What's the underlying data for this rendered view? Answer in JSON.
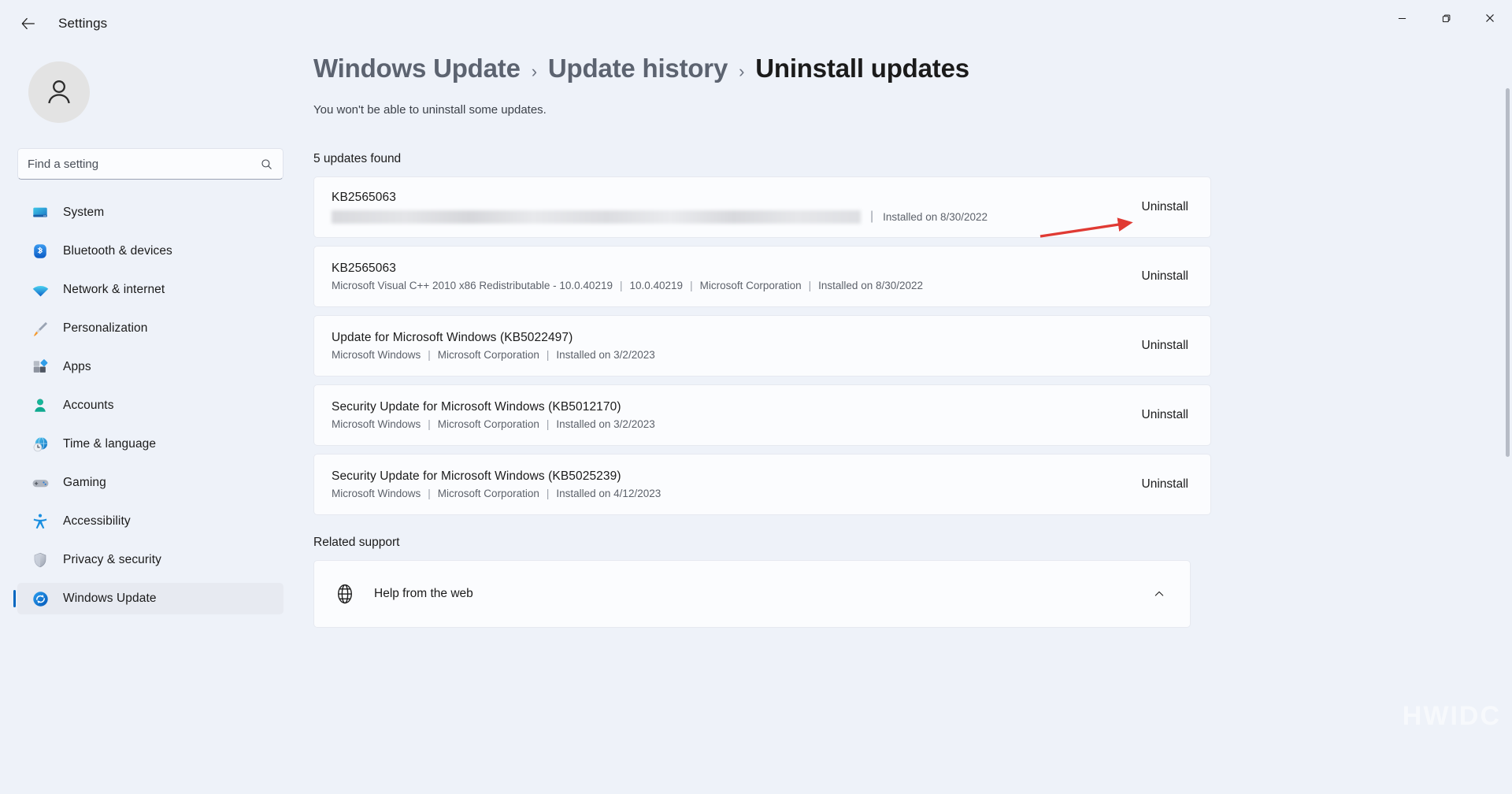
{
  "titlebar": {
    "back_label": "Back",
    "app_title": "Settings",
    "minimize_label": "Minimize",
    "maximize_label": "Restore",
    "close_label": "Close"
  },
  "sidebar": {
    "search_placeholder": "Find a setting",
    "search_value": "",
    "items": [
      {
        "label": "System",
        "icon": "monitor-icon",
        "selected": false
      },
      {
        "label": "Bluetooth & devices",
        "icon": "bluetooth-icon",
        "selected": false
      },
      {
        "label": "Network & internet",
        "icon": "wifi-icon",
        "selected": false
      },
      {
        "label": "Personalization",
        "icon": "paintbrush-icon",
        "selected": false
      },
      {
        "label": "Apps",
        "icon": "apps-icon",
        "selected": false
      },
      {
        "label": "Accounts",
        "icon": "person-icon",
        "selected": false
      },
      {
        "label": "Time & language",
        "icon": "clock-globe-icon",
        "selected": false
      },
      {
        "label": "Gaming",
        "icon": "gamepad-icon",
        "selected": false
      },
      {
        "label": "Accessibility",
        "icon": "accessibility-icon",
        "selected": false
      },
      {
        "label": "Privacy & security",
        "icon": "shield-icon",
        "selected": false
      },
      {
        "label": "Windows Update",
        "icon": "update-icon",
        "selected": true
      }
    ]
  },
  "main": {
    "breadcrumb": [
      {
        "label": "Windows Update",
        "current": false
      },
      {
        "label": "Update history",
        "current": false
      },
      {
        "label": "Uninstall updates",
        "current": true
      }
    ],
    "breadcrumb_separator": "›",
    "subtitle": "You won't be able to uninstall some updates.",
    "count_label": "5 updates found",
    "uninstall_label": "Uninstall",
    "updates": [
      {
        "title": "KB2565063",
        "redacted": true,
        "meta": [
          "Installed on 8/30/2022"
        ]
      },
      {
        "title": "KB2565063",
        "redacted": false,
        "meta": [
          "Microsoft Visual C++ 2010  x86 Redistributable - 10.0.40219",
          "10.0.40219",
          "Microsoft Corporation",
          "Installed on 8/30/2022"
        ]
      },
      {
        "title": "Update for Microsoft Windows (KB5022497)",
        "redacted": false,
        "meta": [
          "Microsoft Windows",
          "Microsoft Corporation",
          "Installed on 3/2/2023"
        ]
      },
      {
        "title": "Security Update for Microsoft Windows (KB5012170)",
        "redacted": false,
        "meta": [
          "Microsoft Windows",
          "Microsoft Corporation",
          "Installed on 3/2/2023"
        ]
      },
      {
        "title": "Security Update for Microsoft Windows (KB5025239)",
        "redacted": false,
        "meta": [
          "Microsoft Windows",
          "Microsoft Corporation",
          "Installed on 4/12/2023"
        ]
      }
    ],
    "related_support_title": "Related support",
    "help_from_web_label": "Help from the web"
  },
  "annotation": {
    "arrow_color": "#e03a33",
    "points_to": "Uninstall"
  },
  "watermark": {
    "text": "HWIDC"
  },
  "colors": {
    "accent": "#0067c0",
    "page_bg": "#eef2f9",
    "card_bg": "#fbfcfe",
    "text_primary": "#1b1b1b",
    "text_secondary": "#5d626b"
  }
}
